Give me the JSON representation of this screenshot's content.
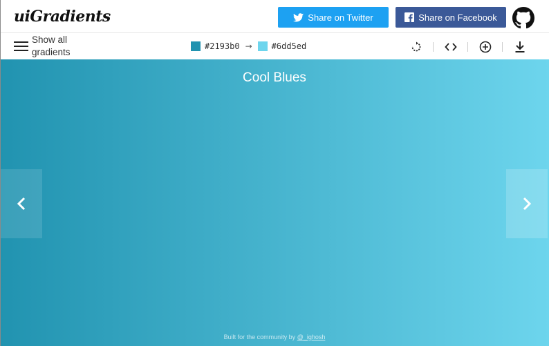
{
  "header": {
    "logo": "uiGradients",
    "twitter_label": "Share on Twitter",
    "facebook_label": "Share on Facebook"
  },
  "toolbar": {
    "menu_label": "Show all gradients",
    "color_start": "#2193b0",
    "color_end": "#6dd5ed",
    "arrow": "→"
  },
  "gradient": {
    "name": "Cool Blues",
    "from": "#2193b0",
    "to": "#6dd5ed"
  },
  "footer": {
    "text": "Built for the community by ",
    "link": "@_ighosh"
  },
  "icons": [
    "twitter-icon",
    "facebook-icon",
    "github-icon",
    "hamburger-icon",
    "rotate-icon",
    "code-icon",
    "add-icon",
    "download-icon",
    "chevron-left-icon",
    "chevron-right-icon"
  ]
}
